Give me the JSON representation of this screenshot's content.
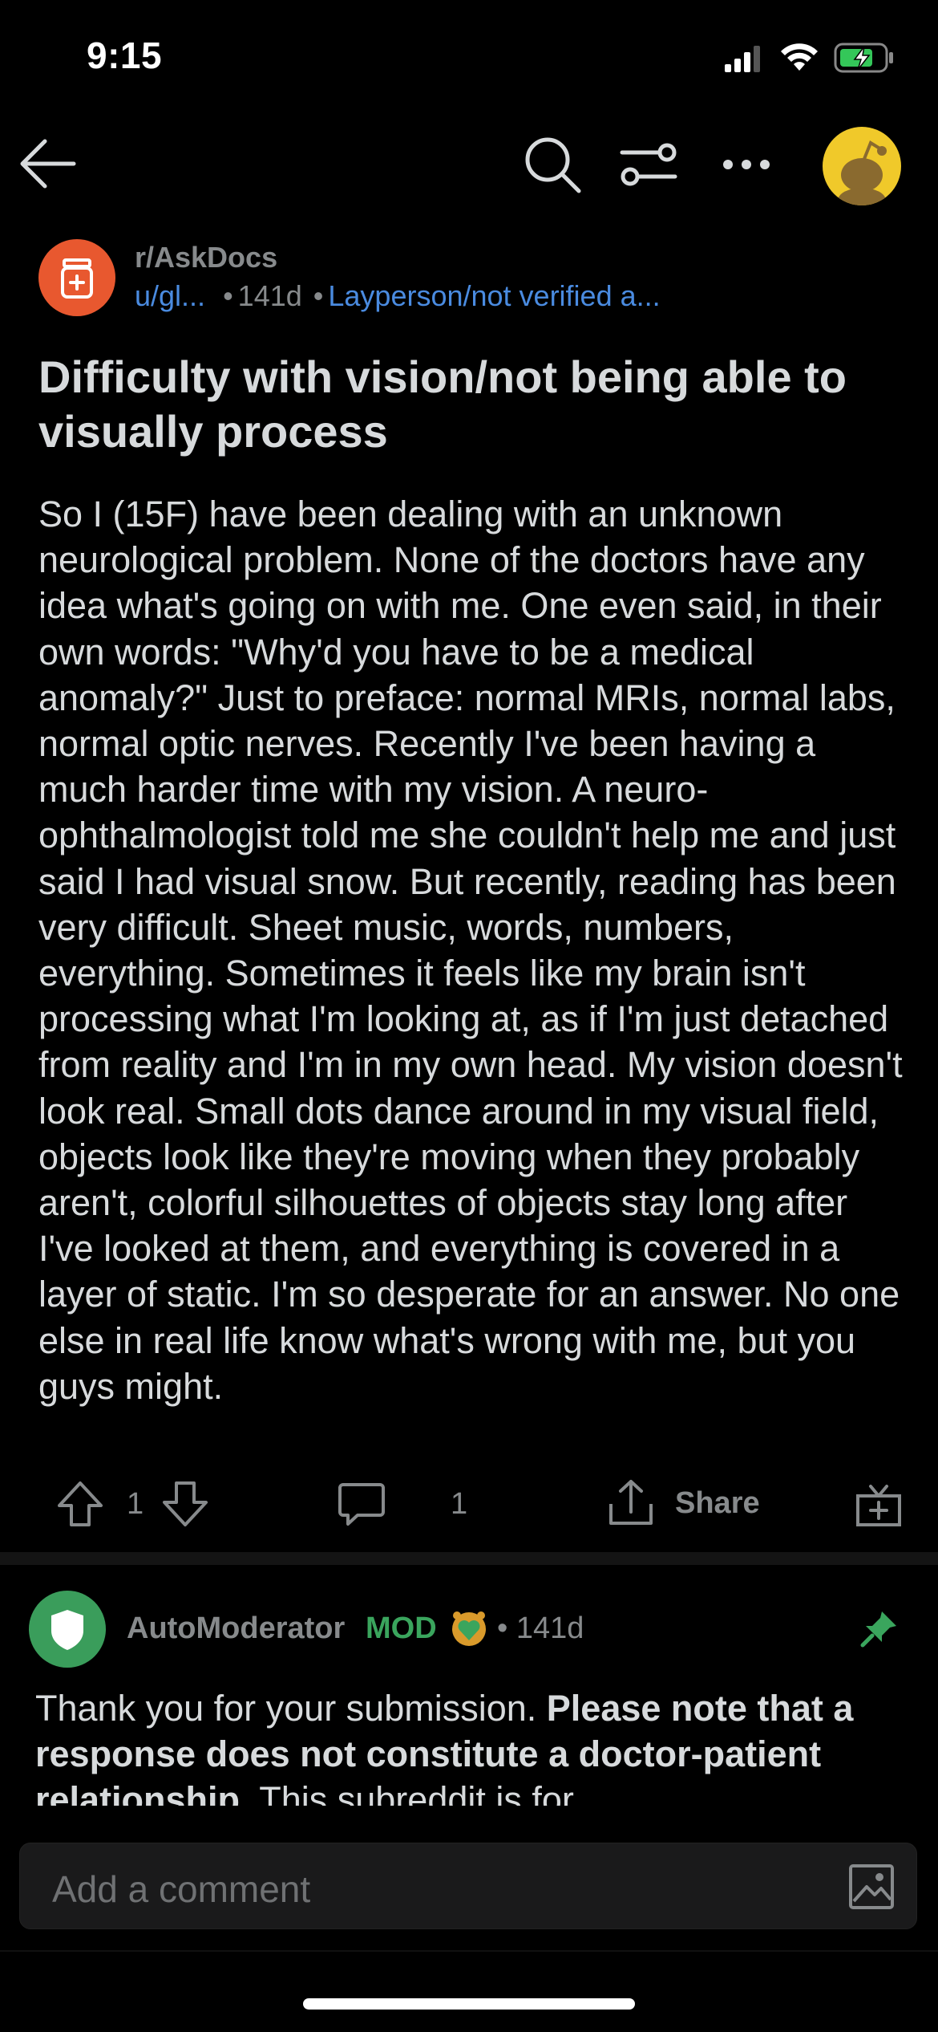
{
  "status_bar": {
    "time": "9:15"
  },
  "nav": {
    "back_icon": "arrow-left-icon",
    "search_icon": "search-icon",
    "sort_icon": "sliders-icon",
    "more_icon": "more-horizontal-icon",
    "avatar": "snoo-avatar"
  },
  "post": {
    "subreddit": "r/AskDocs",
    "username": "u/gl...",
    "age": "141d",
    "flair": "Layperson/not verified a...",
    "title": "Difficulty with vision/not being able to visually process",
    "body": "So I (15F) have been dealing with an unknown neurological problem. None of the doctors have any idea what's going on with me. One even said, in their own words: \"Why'd you have to be a medical anomaly?\" Just to preface: normal MRIs, normal labs, normal optic nerves. Recently I've been having a much harder time with my vision. A neuro-ophthalmologist told me she couldn't help me and just said I had visual snow. But recently, reading has been very difficult. Sheet music, words, numbers, everything. Sometimes it feels like my brain isn't processing what I'm looking at, as if I'm just detached from reality and I'm in my own head. My vision doesn't look real. Small dots dance around in my visual field, objects look like they're moving when they probably aren't, colorful silhouettes of objects stay long after I've looked at them, and everything is covered in a layer of static. I'm so desperate for an answer. No one else in real life know what's wrong with me, but you guys might.",
    "actions": {
      "votes": "1",
      "comments": "1",
      "share_label": "Share"
    }
  },
  "comment": {
    "author": "AutoModerator",
    "badge": "MOD",
    "age": "141d",
    "text_start": "Thank you for your submission. ",
    "text_bold": "Please note that a response does not constitute a doctor-patient relationship.",
    "text_end": " This subreddit is for"
  },
  "composer": {
    "placeholder": "Add a comment"
  },
  "colors": {
    "background": "#000000",
    "subreddit_icon": "#e8582f",
    "link_blue": "#4a8be0",
    "mod_green": "#3aa55d",
    "avatar_yellow": "#f0c92a"
  }
}
